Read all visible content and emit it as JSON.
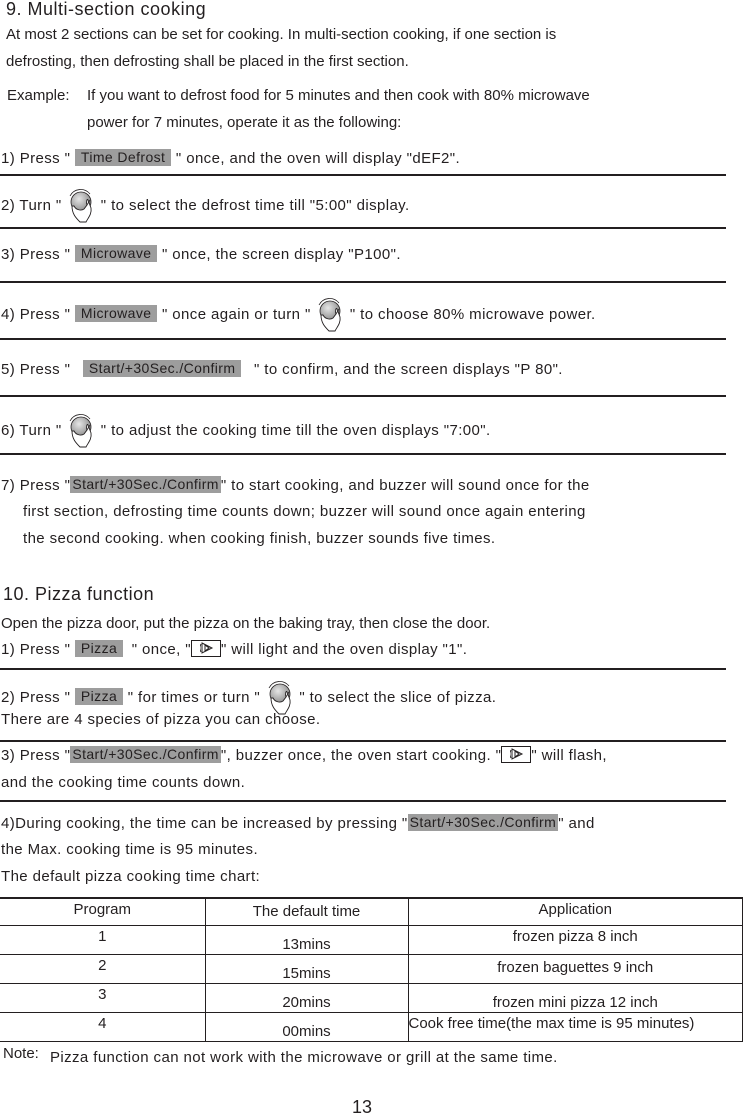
{
  "section9": {
    "title": "9. Multi-section cooking",
    "intro_line1": "At most 2 sections can be set for cooking. In multi-section cooking, if one section is",
    "intro_line2": "defrosting, then defrosting shall be placed in the first section.",
    "example_label": "Example:",
    "example_line1": "If you want to defrost  food for 5 minutes and then cook with 80% microwave",
    "example_line2": "power for 7 minutes, operate it as the following:",
    "steps": [
      {
        "pre": "1) Press \"",
        "button": "Time Defrost",
        "post": "\" once, and the oven will display \"dEF2\"."
      },
      {
        "pre": "2) Turn \"",
        "icon": "dial-knob",
        "post": "\" to select the defrost time till \"5:00\" display."
      },
      {
        "pre": "3) Press \"",
        "button": "Microwave",
        "post": "\" once, the screen display \"P100\"."
      },
      {
        "pre": "4) Press \"",
        "button": "Microwave",
        "mid": "\" once again or turn \"",
        "icon": "dial-knob",
        "post": "\" to choose 80% microwave power."
      },
      {
        "pre": "5) Press \"",
        "button": "Start/+30Sec./Confirm",
        "post": "\" to confirm, and the screen displays \"P 80\"."
      },
      {
        "pre": "6) Turn \"",
        "icon": "dial-knob",
        "post": "\" to adjust the cooking time till the oven displays \"7:00\"."
      },
      {
        "pre": "7) Press \"",
        "button": "Start/+30Sec./Confirm",
        "post": "\" to start cooking, and buzzer will sound once for the",
        "line2": "first section, defrosting time counts down; buzzer will sound once again entering",
        "line3": "the second cooking. when cooking finish, buzzer sounds five times."
      }
    ]
  },
  "section10": {
    "title": "10. Pizza function",
    "intro": "Open the pizza door, put the pizza on the baking tray, then close the door.",
    "steps": [
      {
        "pre": "1) Press \"",
        "button": "Pizza",
        "mid": "\" once, \"",
        "icon": "pizza-indicator",
        "post": "\" will light and the oven display \"1\"."
      },
      {
        "pre": "2) Press \"",
        "button": "Pizza",
        "mid": "\" for times or turn \"",
        "icon": "dial-knob",
        "post": "\" to select the slice of pizza.",
        "line2": "There are 4 species of pizza you can choose."
      },
      {
        "pre": "3) Press \"",
        "button": "Start/+30Sec./Confirm",
        "mid": "\", buzzer once, the oven start cooking. \"",
        "icon": "pizza-indicator",
        "post": "\" will flash,",
        "line2": "and the cooking time counts down."
      },
      {
        "pre": "4)During cooking, the time can be increased by pressing \"",
        "button": "Start/+30Sec./Confirm",
        "post": "\" and",
        "line2": "the Max. cooking time is 95 minutes."
      }
    ],
    "chart_caption": "The default pizza cooking time chart:",
    "table": {
      "headers": [
        "Program",
        "The default time",
        "Application"
      ],
      "rows": [
        [
          "1",
          "13mins",
          "frozen pizza 8 inch"
        ],
        [
          "2",
          "15mins",
          "frozen baguettes 9 inch"
        ],
        [
          "3",
          "20mins",
          "frozen mini pizza 12 inch"
        ],
        [
          "4",
          "00mins",
          "Cook free time(the max time is 95 minutes)"
        ]
      ]
    },
    "note_label": "Note:",
    "note_text": "Pizza function can not work with the microwave or grill at the same time."
  },
  "page_number": "13",
  "colors": {
    "text": "#231f20",
    "button_bg": "#9d9d9d",
    "rule": "#231f20"
  }
}
